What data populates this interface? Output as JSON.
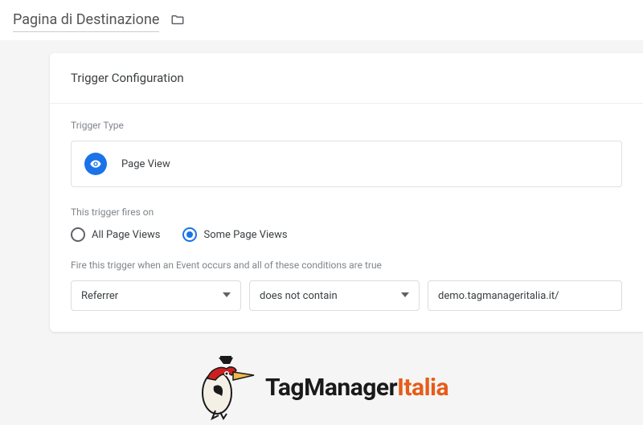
{
  "header": {
    "title": "Pagina di Destinazione"
  },
  "card": {
    "heading": "Trigger Configuration",
    "trigger_type_label": "Trigger Type",
    "trigger_type_name": "Page View",
    "fires_on_label": "This trigger fires on",
    "radio_all": "All Page Views",
    "radio_some": "Some Page Views",
    "condition_label": "Fire this trigger when an Event occurs and all of these conditions are true",
    "condition_variable": "Referrer",
    "condition_operator": "does not contain",
    "condition_value": "demo.tagmanageritalia.it/"
  },
  "logo": {
    "part1": "TagManager",
    "part2": "Italia"
  }
}
